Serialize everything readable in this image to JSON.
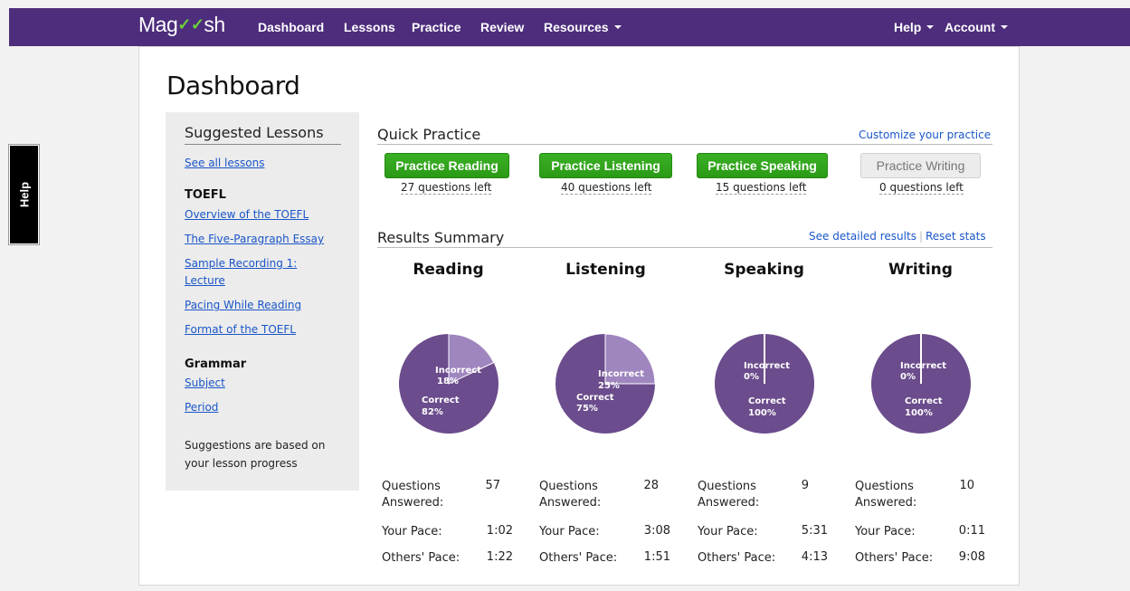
{
  "nav": {
    "logo_left": "Mag",
    "logo_right": "sh",
    "items": [
      {
        "label": "Dashboard"
      },
      {
        "label": "Lessons"
      },
      {
        "label": "Practice"
      },
      {
        "label": "Review"
      },
      {
        "label": "Resources"
      }
    ],
    "help": "Help",
    "account": "Account"
  },
  "help_tab": "Help",
  "page_title": "Dashboard",
  "sidebar": {
    "heading": "Suggested Lessons",
    "see_all": "See all lessons",
    "toefl_heading": "TOEFL",
    "toefl_lessons": [
      "Overview of the TOEFL",
      "The Five-Paragraph Essay",
      "Sample Recording 1:",
      "Lecture",
      "Pacing While Reading",
      "Format of the TOEFL"
    ],
    "grammar_heading": "Grammar",
    "grammar_lessons": [
      "Subject",
      "Period"
    ],
    "note": "Suggestions are based on your lesson progress"
  },
  "quick_practice": {
    "heading": "Quick Practice",
    "customize": "Customize your practice",
    "buttons": [
      {
        "label": "Practice Reading",
        "left": "27 questions left"
      },
      {
        "label": "Practice Listening",
        "left": "40 questions left"
      },
      {
        "label": "Practice Speaking",
        "left": "15 questions left"
      },
      {
        "label": "Practice Writing",
        "left": "0 questions left"
      }
    ]
  },
  "results": {
    "heading": "Results Summary",
    "detailed": "See detailed results",
    "reset": "Reset stats",
    "sections": [
      {
        "title": "Reading",
        "incorrect_label": "Incorrect",
        "incorrect_pct": "18%",
        "correct_label": "Correct",
        "correct_pct": "82%",
        "incorrect_fraction": 0.18,
        "questions_label": "Questions",
        "answered_label": "Answered:",
        "questions": "57",
        "pace_label": "Your Pace:",
        "pace": "1:02",
        "others_label": "Others' Pace:",
        "others": "1:22"
      },
      {
        "title": "Listening",
        "incorrect_label": "Incorrect",
        "incorrect_pct": "25%",
        "correct_label": "Correct",
        "correct_pct": "75%",
        "incorrect_fraction": 0.25,
        "questions_label": "Questions",
        "answered_label": "Answered:",
        "questions": "28",
        "pace_label": "Your Pace:",
        "pace": "3:08",
        "others_label": "Others' Pace:",
        "others": "1:51"
      },
      {
        "title": "Speaking",
        "incorrect_label": "Incorrect",
        "incorrect_pct": "0%",
        "correct_label": "Correct",
        "correct_pct": "100%",
        "incorrect_fraction": 0,
        "questions_label": "Questions",
        "answered_label": "Answered:",
        "questions": "9",
        "pace_label": "Your Pace:",
        "pace": "5:31",
        "others_label": "Others' Pace:",
        "others": "4:13"
      },
      {
        "title": "Writing",
        "incorrect_label": "Incorrect",
        "incorrect_pct": "0%",
        "correct_label": "Correct",
        "correct_pct": "100%",
        "incorrect_fraction": 0,
        "questions_label": "Questions",
        "answered_label": "Answered:",
        "questions": "10",
        "pace_label": "Your Pace:",
        "pace": "0:11",
        "others_label": "Others' Pace:",
        "others": "9:08"
      }
    ]
  },
  "colors": {
    "nav_bg": "#4d2d7c",
    "pie_correct": "#6b4c8c",
    "pie_incorrect": "#9f86bf",
    "button_green": "#2fa31b",
    "link_blue": "#1a56c8"
  }
}
